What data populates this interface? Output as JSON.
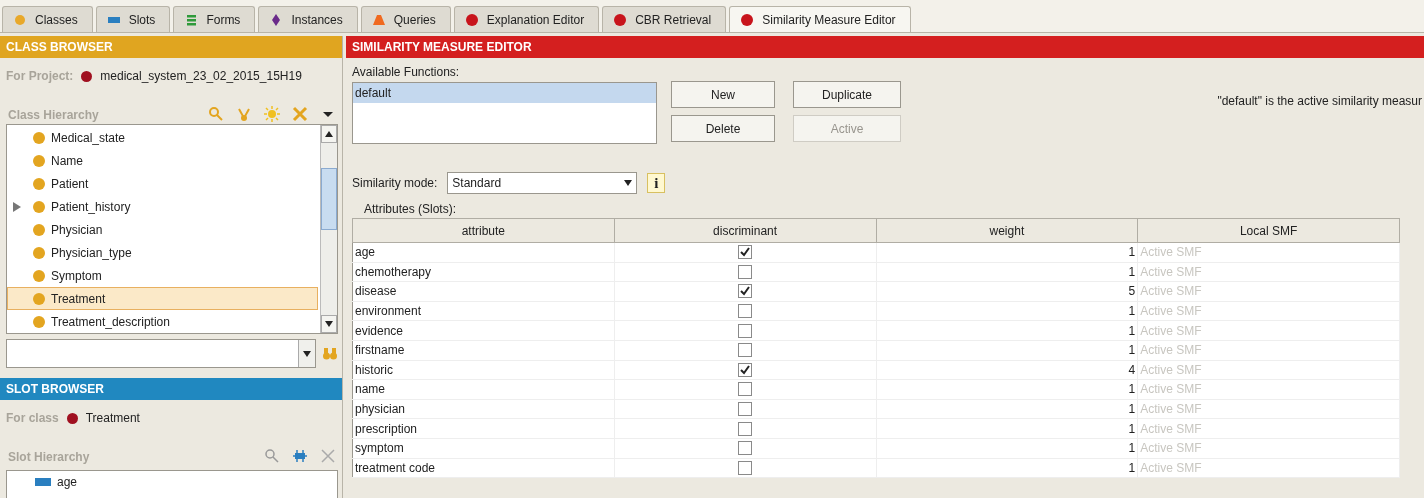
{
  "tabs": [
    {
      "label": "Classes",
      "selected": false
    },
    {
      "label": "Slots",
      "selected": false
    },
    {
      "label": "Forms",
      "selected": false
    },
    {
      "label": "Instances",
      "selected": false
    },
    {
      "label": "Queries",
      "selected": false
    },
    {
      "label": "Explanation Editor",
      "selected": false
    },
    {
      "label": "CBR Retrieval",
      "selected": false
    },
    {
      "label": "Similarity Measure Editor",
      "selected": true
    }
  ],
  "class_browser": {
    "title": "CLASS BROWSER",
    "project_label": "For Project:",
    "project": "medical_system_23_02_2015_15H19",
    "hierarchy_label": "Class Hierarchy",
    "classes": [
      {
        "name": "Medical_state",
        "has_children": false,
        "selected": false
      },
      {
        "name": "Name",
        "has_children": false,
        "selected": false
      },
      {
        "name": "Patient",
        "has_children": false,
        "selected": false
      },
      {
        "name": "Patient_history",
        "has_children": true,
        "selected": false
      },
      {
        "name": "Physician",
        "has_children": false,
        "selected": false
      },
      {
        "name": "Physician_type",
        "has_children": false,
        "selected": false
      },
      {
        "name": "Symptom",
        "has_children": false,
        "selected": false
      },
      {
        "name": "Treatment",
        "has_children": false,
        "selected": true
      },
      {
        "name": "Treatment_description",
        "has_children": false,
        "selected": false
      }
    ]
  },
  "slot_browser": {
    "title": "SLOT BROWSER",
    "class_label": "For class",
    "class": "Treatment",
    "hierarchy_label": "Slot Hierarchy",
    "slots": [
      "age"
    ]
  },
  "editor": {
    "title": "SIMILARITY MEASURE EDITOR",
    "functions_label": "Available Functions:",
    "functions": [
      {
        "name": "default",
        "selected": true
      }
    ],
    "buttons": [
      {
        "label": "New",
        "disabled": false
      },
      {
        "label": "Duplicate",
        "disabled": false
      },
      {
        "label": "Delete",
        "disabled": false
      },
      {
        "label": "Active",
        "disabled": true
      }
    ],
    "status": "\"default\" is the active similarity measur",
    "mode_label": "Similarity mode:",
    "mode": "Standard",
    "info": "i",
    "attributes_label": "Attributes (Slots):",
    "columns": [
      "attribute",
      "discriminant",
      "weight",
      "Local SMF"
    ],
    "rows": [
      {
        "attribute": "age",
        "discriminant": true,
        "weight": "1",
        "local_smf": "Active SMF"
      },
      {
        "attribute": "chemotherapy",
        "discriminant": false,
        "weight": "1",
        "local_smf": "Active SMF"
      },
      {
        "attribute": "disease",
        "discriminant": true,
        "weight": "5",
        "local_smf": "Active SMF"
      },
      {
        "attribute": "environment",
        "discriminant": false,
        "weight": "1",
        "local_smf": "Active SMF"
      },
      {
        "attribute": "evidence",
        "discriminant": false,
        "weight": "1",
        "local_smf": "Active SMF"
      },
      {
        "attribute": "firstname",
        "discriminant": false,
        "weight": "1",
        "local_smf": "Active SMF"
      },
      {
        "attribute": "historic",
        "discriminant": true,
        "weight": "4",
        "local_smf": "Active SMF"
      },
      {
        "attribute": "name",
        "discriminant": false,
        "weight": "1",
        "local_smf": "Active SMF"
      },
      {
        "attribute": "physician",
        "discriminant": false,
        "weight": "1",
        "local_smf": "Active SMF"
      },
      {
        "attribute": "prescription",
        "discriminant": false,
        "weight": "1",
        "local_smf": "Active SMF"
      },
      {
        "attribute": "symptom",
        "discriminant": false,
        "weight": "1",
        "local_smf": "Active SMF"
      },
      {
        "attribute": "treatment code",
        "discriminant": false,
        "weight": "1",
        "local_smf": "Active SMF"
      }
    ]
  }
}
